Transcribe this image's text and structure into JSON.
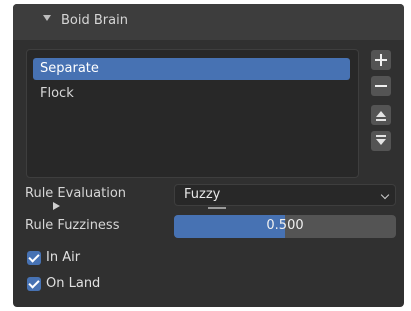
{
  "panel": {
    "title": "Boid Brain"
  },
  "rules_list": {
    "items": [
      {
        "label": "Separate",
        "selected": true
      },
      {
        "label": "Flock",
        "selected": false
      }
    ]
  },
  "side_buttons": {
    "add": "plus-icon",
    "remove": "minus-icon",
    "move_up": "move-up-icon",
    "move_down": "move-down-icon"
  },
  "properties": {
    "rule_evaluation": {
      "label": "Rule Evaluation",
      "value": "Fuzzy"
    },
    "rule_fuzziness": {
      "label": "Rule Fuzziness",
      "value": "0.500",
      "fraction": 0.5
    }
  },
  "checkboxes": {
    "in_air": {
      "label": "In Air",
      "checked": true
    },
    "on_land": {
      "label": "On Land",
      "checked": true
    }
  },
  "colors": {
    "accent": "#4772b3",
    "panel_bg": "#303030",
    "header_bg": "#3d3d3d",
    "field_bg": "#282828",
    "button_bg": "#545454"
  }
}
